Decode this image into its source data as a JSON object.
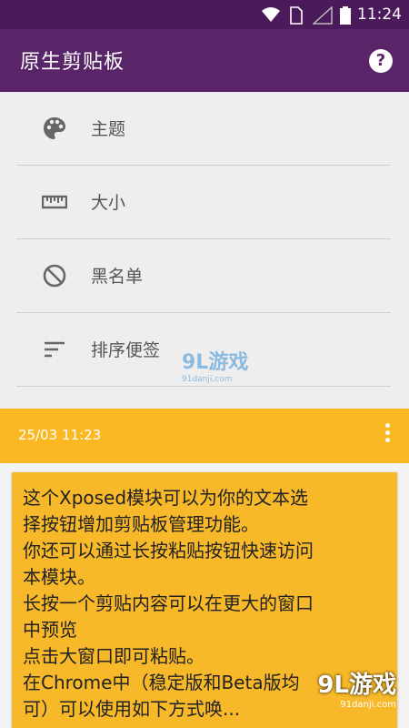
{
  "status_bar": {
    "time": "11:24"
  },
  "app_bar": {
    "title": "原生剪贴板"
  },
  "menu": {
    "items": [
      {
        "label": "主题",
        "icon": "palette-icon"
      },
      {
        "label": "大小",
        "icon": "ruler-icon"
      },
      {
        "label": "黑名单",
        "icon": "block-icon"
      },
      {
        "label": "排序便签",
        "icon": "sort-icon"
      }
    ]
  },
  "note": {
    "timestamp": "25/03 11:23",
    "text": "这个Xposed模块可以为你的文本选\n择按钮增加剪贴板管理功能。\n你还可以通过长按粘贴按钮快速访问\n本模块。\n长按一个剪贴内容可以在更大的窗口\n中预览\n点击大窗口即可粘贴。\n在Chrome中（稳定版和Beta版均\n可）可以使用如下方式唤..."
  },
  "watermarks": {
    "center": "9L游戏",
    "center_sub": "91danji.com",
    "corner": "9L游戏",
    "corner_sub": "91danji.com"
  },
  "colors": {
    "appbar": "#5a2468",
    "accent": "#fbb823"
  }
}
